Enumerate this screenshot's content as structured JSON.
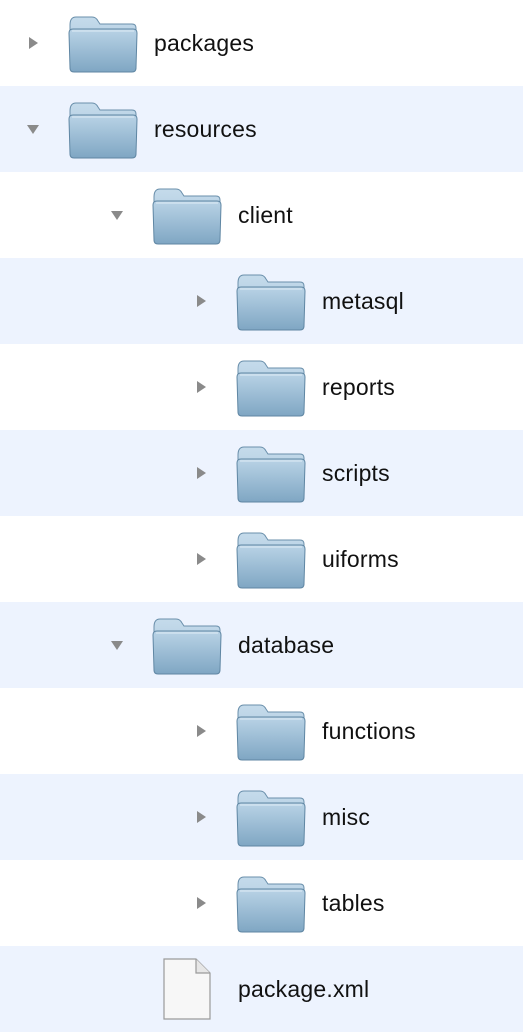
{
  "tree": {
    "rows": [
      {
        "label": "packages",
        "type": "folder",
        "state": "collapsed",
        "depth": 0
      },
      {
        "label": "resources",
        "type": "folder",
        "state": "expanded",
        "depth": 0
      },
      {
        "label": "client",
        "type": "folder",
        "state": "expanded",
        "depth": 1
      },
      {
        "label": "metasql",
        "type": "folder",
        "state": "collapsed",
        "depth": 2
      },
      {
        "label": "reports",
        "type": "folder",
        "state": "collapsed",
        "depth": 2
      },
      {
        "label": "scripts",
        "type": "folder",
        "state": "collapsed",
        "depth": 2
      },
      {
        "label": "uiforms",
        "type": "folder",
        "state": "collapsed",
        "depth": 2
      },
      {
        "label": "database",
        "type": "folder",
        "state": "expanded",
        "depth": 1
      },
      {
        "label": "functions",
        "type": "folder",
        "state": "collapsed",
        "depth": 2
      },
      {
        "label": "misc",
        "type": "folder",
        "state": "collapsed",
        "depth": 2
      },
      {
        "label": "tables",
        "type": "folder",
        "state": "collapsed",
        "depth": 2
      },
      {
        "label": "package.xml",
        "type": "file",
        "state": "none",
        "depth": 1
      }
    ]
  },
  "icons": {
    "folder": "folder-icon",
    "file": "document-icon",
    "collapsed": "disclosure-triangle-right-icon",
    "expanded": "disclosure-triangle-down-icon"
  },
  "colors": {
    "stripe": "#edf3fe",
    "folder_body": "#8fb4cf",
    "folder_tab": "#a8c6dc",
    "disclosure": "#8a8a8a"
  }
}
